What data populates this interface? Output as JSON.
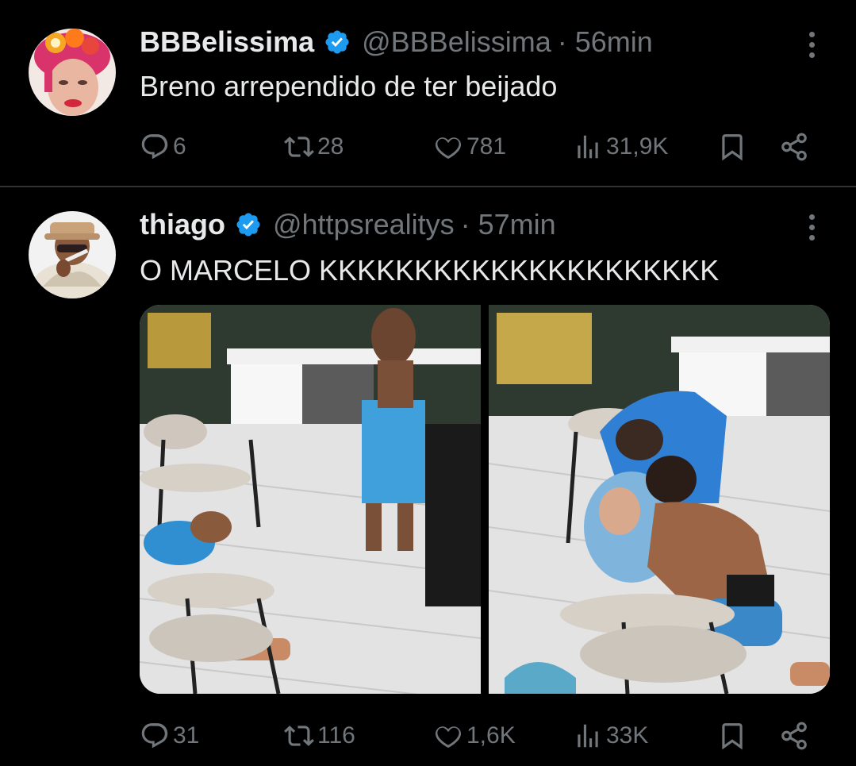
{
  "tweets": [
    {
      "name": "BBBelissima",
      "handle": "@BBBelissima",
      "time": "· 56min",
      "text": "Breno arrependido de ter beijado",
      "stats": {
        "replies": "6",
        "reposts": "28",
        "likes": "781",
        "views": "31,9K"
      }
    },
    {
      "name": "thiago",
      "handle": "@httpsrealitys",
      "time": "· 57min",
      "text": "O MARCELO KKKKKKKKKKKKKKKKKKKKK",
      "stats": {
        "replies": "31",
        "reposts": "116",
        "likes": "1,6K",
        "views": "33K"
      }
    }
  ],
  "colors": {
    "background": "#000000",
    "text": "#e7e9ea",
    "muted": "#71767b",
    "verified": "#1d9bf0",
    "divider": "#2f3336"
  },
  "icons": [
    "reply-icon",
    "repost-icon",
    "like-icon",
    "views-icon",
    "bookmark-icon",
    "share-icon",
    "more-icon",
    "verified-badge-icon"
  ]
}
